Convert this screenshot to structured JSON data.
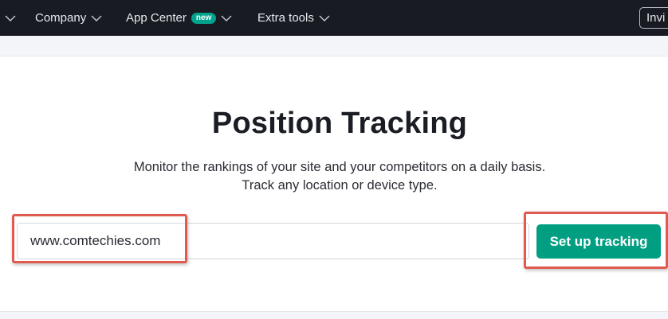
{
  "nav": {
    "items": [
      {
        "label": "",
        "has_chevron": true
      },
      {
        "label": "Company",
        "has_chevron": true
      },
      {
        "label": "App Center",
        "badge": "new",
        "has_chevron": true
      },
      {
        "label": "Extra tools",
        "has_chevron": true
      }
    ],
    "invite_label": "Invi"
  },
  "hero": {
    "title": "Position Tracking",
    "subtitle_line1": "Monitor the rankings of your site and your competitors on a daily basis.",
    "subtitle_line2": "Track any location or device type."
  },
  "form": {
    "domain_value": "www.comtechies.com",
    "button_label": "Set up tracking"
  },
  "colors": {
    "nav_bg": "#191b23",
    "badge": "#00a38b",
    "button": "#009f81",
    "highlight": "#e05a50"
  }
}
